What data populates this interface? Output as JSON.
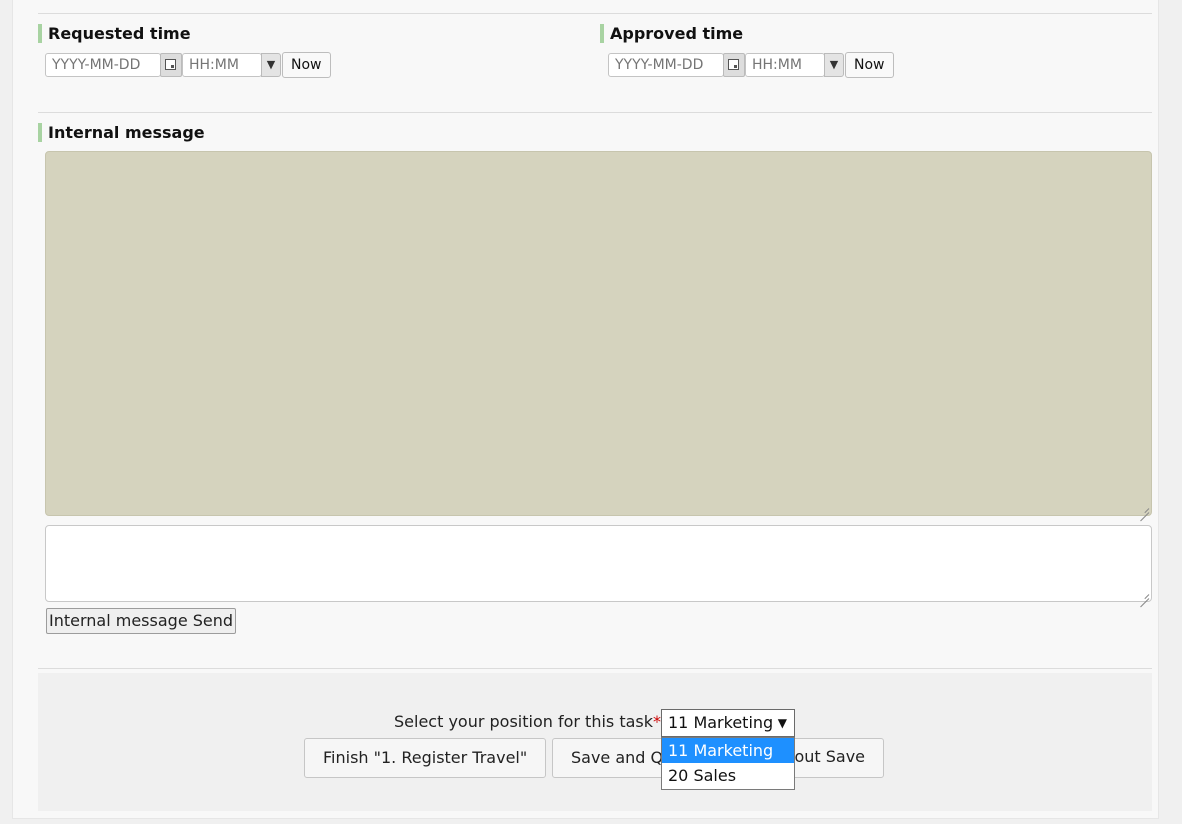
{
  "requested": {
    "label": "Requested time",
    "date_placeholder": "YYYY-MM-DD",
    "time_placeholder": "HH:MM",
    "now_label": "Now"
  },
  "approved": {
    "label": "Approved time",
    "date_placeholder": "YYYY-MM-DD",
    "time_placeholder": "HH:MM",
    "now_label": "Now"
  },
  "internal_message": {
    "label": "Internal message",
    "send_label": "Internal message Send"
  },
  "footer": {
    "position_label": "Select your position for this task",
    "required_mark": "*",
    "selected_position": "11 Marketing",
    "options": [
      "11 Marketing",
      "20 Sales"
    ],
    "finish_label": "Finish \"1. Register Travel\"",
    "save_quit_label": "Save and Quit",
    "quit_label": "Quit without Save"
  },
  "colors": {
    "accent_bar": "#a8d3a2",
    "history_bg": "#d5d3be",
    "option_highlight": "#1e90ff"
  }
}
